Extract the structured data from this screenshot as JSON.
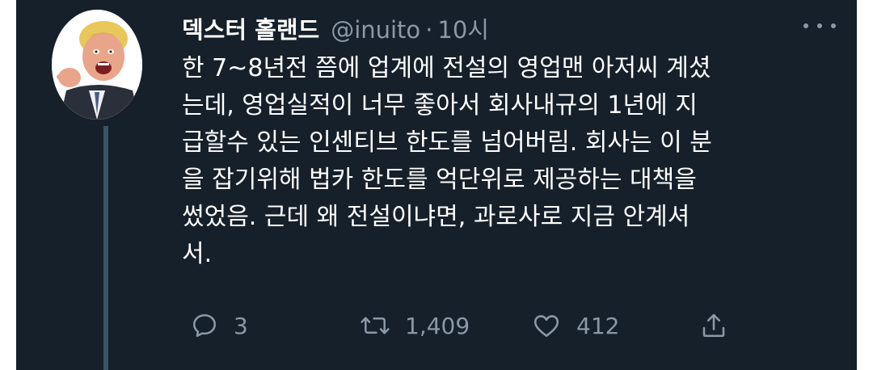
{
  "tweet": {
    "author_name": "덱스터 홀랜드",
    "handle": "@inuito",
    "separator": "·",
    "time": "10시",
    "text_lines": [
      "한 7~8년전 쯤에 업계에 전설의 영업맨 아저씨 계셨",
      "는데, 영업실적이 너무 좋아서 회사내규의 1년에 지",
      "급할수 있는 인센티브 한도를 넘어버림. 회사는 이 분",
      "을 잡기위해 법카 한도를 억단위로 제공하는 대책을",
      "썼었음. 근데 왜 전설이냐면, 과로사로 지금 안계셔",
      "서."
    ],
    "more_icon": "more-horizontal-icon"
  },
  "actions": {
    "reply": {
      "icon": "reply-icon",
      "count": "3"
    },
    "retweet": {
      "icon": "retweet-icon",
      "count": "1,409"
    },
    "like": {
      "icon": "heart-icon",
      "count": "412"
    },
    "share": {
      "icon": "share-icon"
    }
  },
  "colors": {
    "background": "#15202b",
    "text": "#ffffff",
    "secondary": "#8b98a5",
    "thread_line": "#3d5466"
  }
}
